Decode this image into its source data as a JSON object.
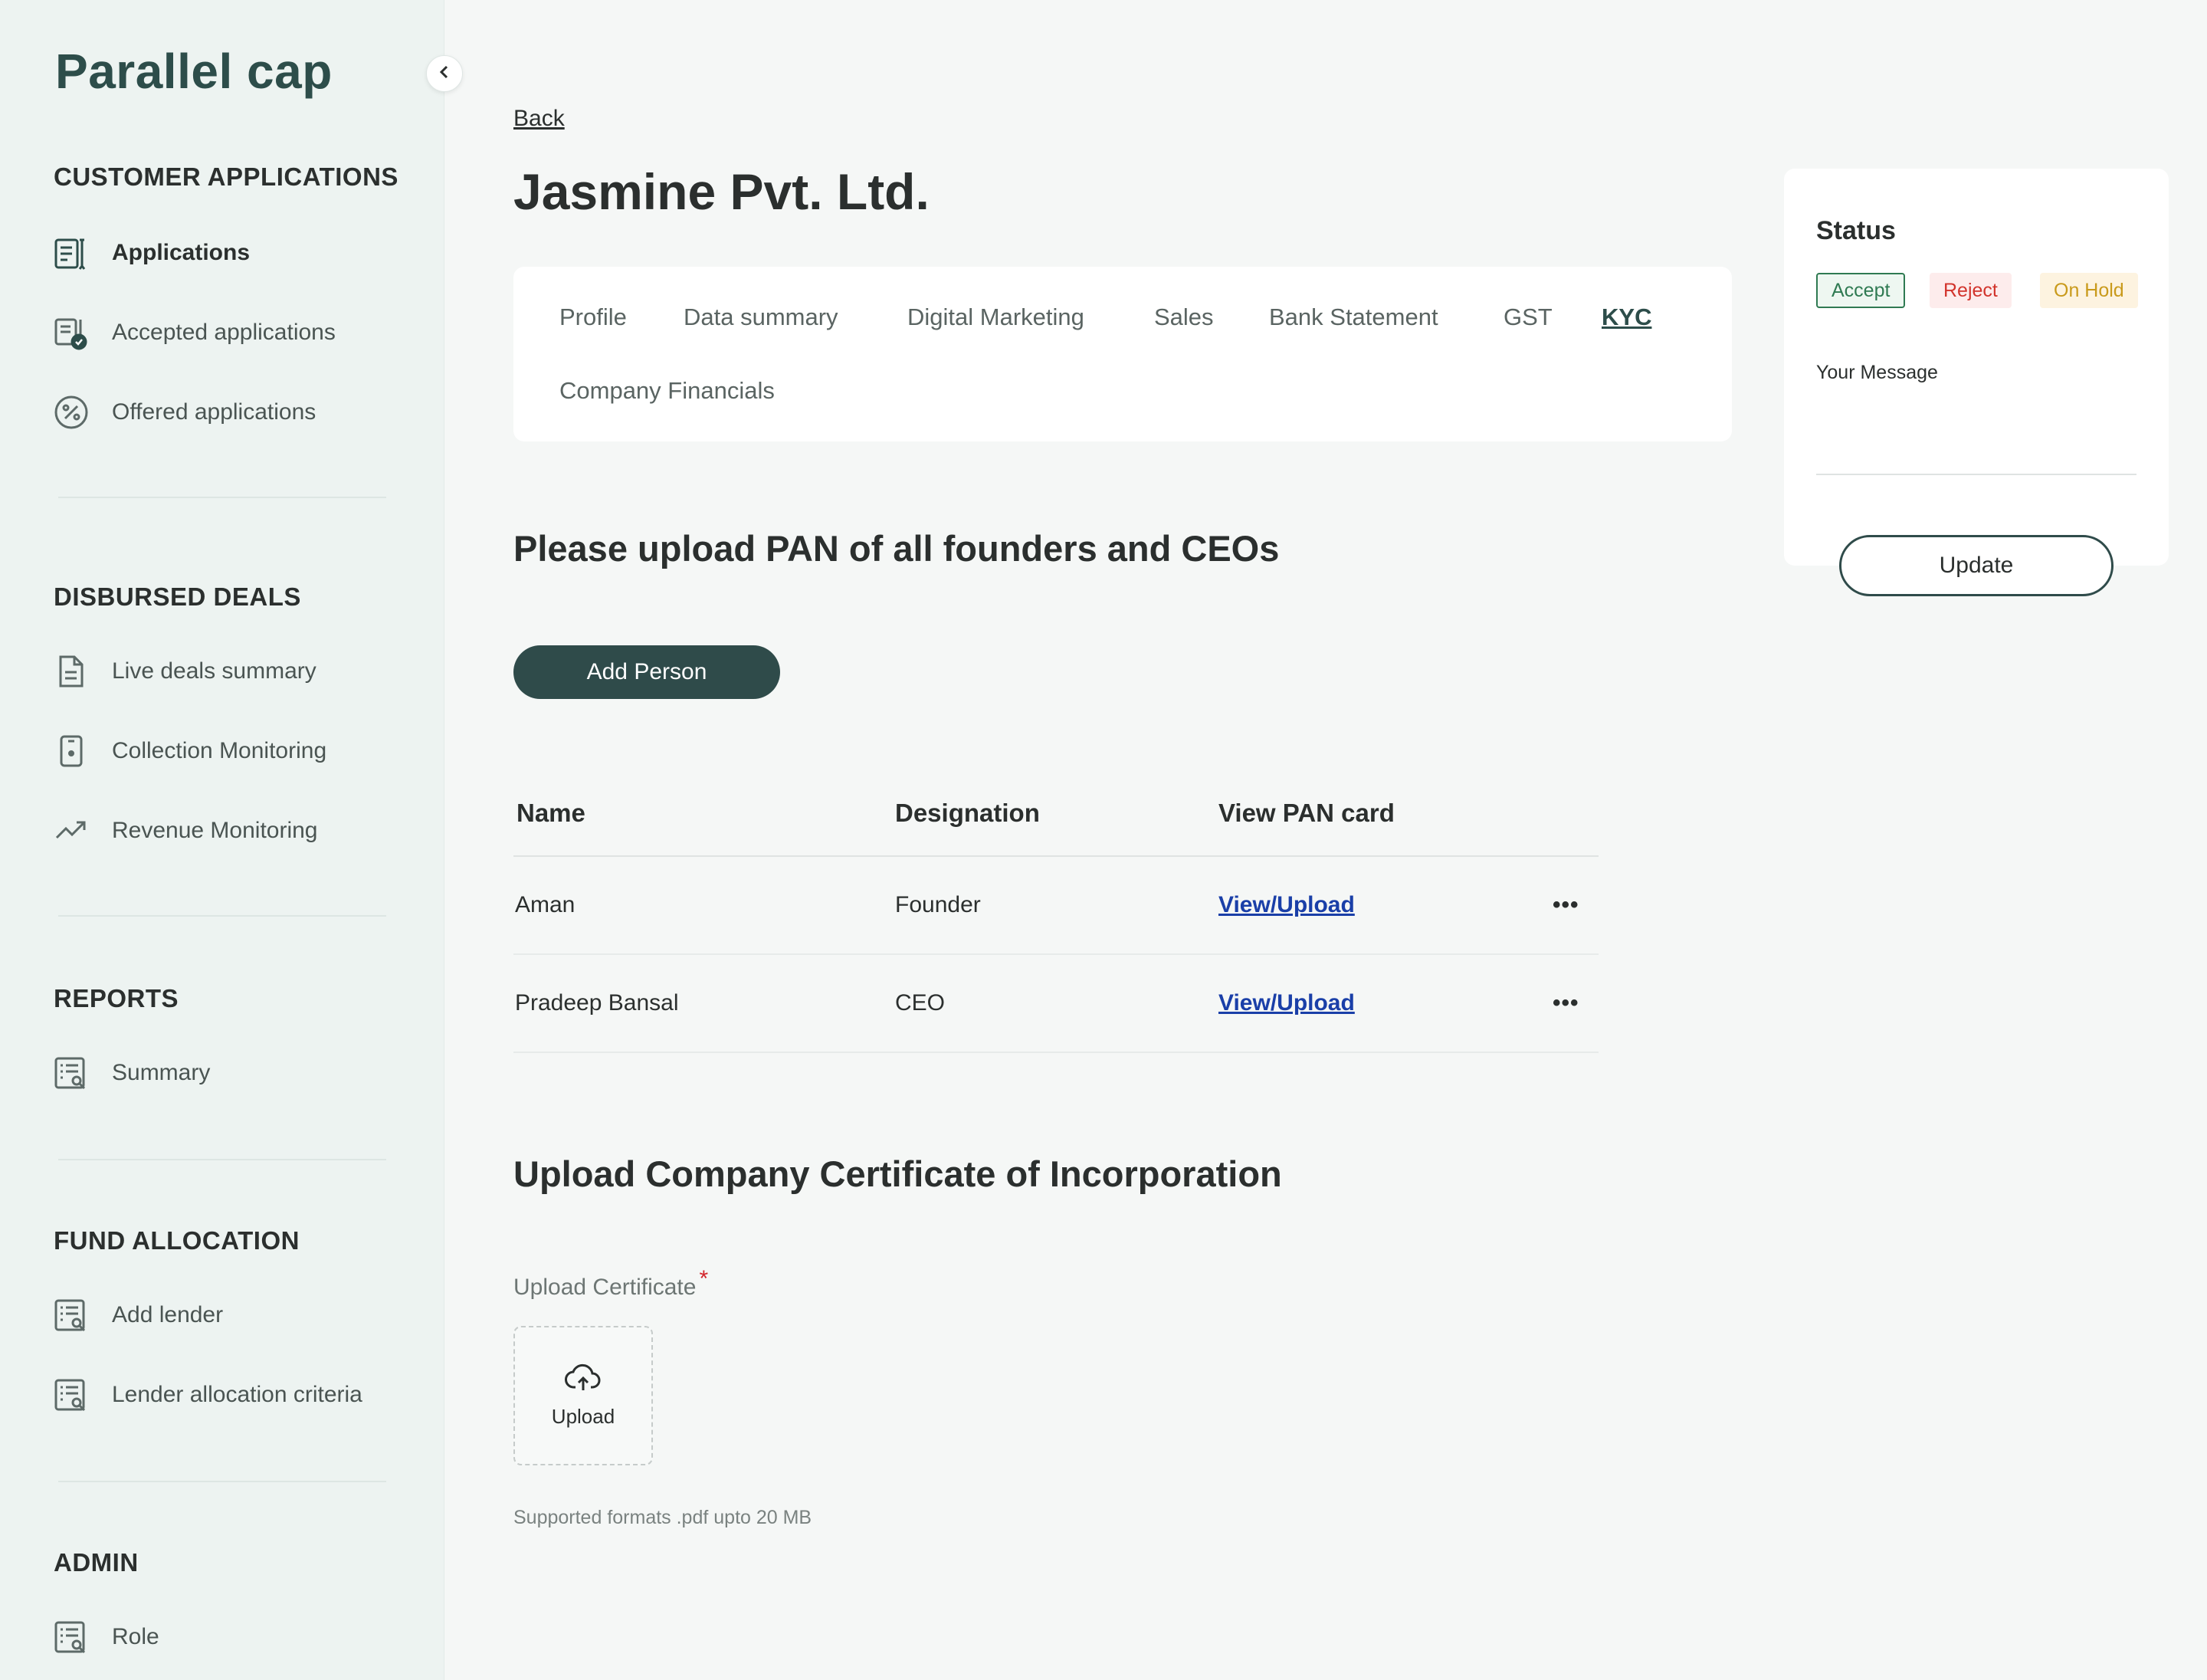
{
  "app": {
    "brand": "Parallel cap"
  },
  "sidebar": {
    "sections": [
      {
        "title": "CUSTOMER APPLICATIONS",
        "items": [
          {
            "label": "Applications",
            "icon": "applications-icon",
            "active": true
          },
          {
            "label": "Accepted applications",
            "icon": "accepted-applications-icon"
          },
          {
            "label": "Offered applications",
            "icon": "percent-icon"
          }
        ]
      },
      {
        "title": "DISBURSED DEALS",
        "items": [
          {
            "label": "Live deals summary",
            "icon": "document-icon"
          },
          {
            "label": "Collection Monitoring",
            "icon": "device-icon"
          },
          {
            "label": "Revenue Monitoring",
            "icon": "trending-up-icon"
          }
        ]
      },
      {
        "title": "REPORTS",
        "items": [
          {
            "label": "Summary",
            "icon": "report-search-icon"
          }
        ]
      },
      {
        "title": "FUND ALLOCATION",
        "items": [
          {
            "label": "Add lender",
            "icon": "report-search-icon"
          },
          {
            "label": "Lender allocation criteria",
            "icon": "report-search-icon"
          }
        ]
      },
      {
        "title": "ADMIN",
        "items": [
          {
            "label": "Role",
            "icon": "report-search-icon"
          }
        ]
      }
    ]
  },
  "main": {
    "back_label": "Back",
    "title": "Jasmine Pvt. Ltd.",
    "tabs": [
      {
        "label": "Profile"
      },
      {
        "label": "Data summary"
      },
      {
        "label": "Digital Marketing"
      },
      {
        "label": "Sales"
      },
      {
        "label": "Bank Statement"
      },
      {
        "label": "GST"
      },
      {
        "label": "KYC",
        "active": true
      },
      {
        "label": "Company Financials"
      }
    ],
    "pan_section": {
      "heading": "Please upload PAN of all founders and CEOs",
      "add_button": "Add Person",
      "columns": [
        "Name",
        "Designation",
        "View PAN card"
      ],
      "rows": [
        {
          "name": "Aman",
          "designation": "Founder",
          "link": "View/Upload",
          "more": "•••"
        },
        {
          "name": "Pradeep Bansal",
          "designation": "CEO",
          "link": "View/Upload",
          "more": "•••"
        }
      ]
    },
    "certificate_section": {
      "heading": "Upload Company Certificate of Incorporation",
      "label": "Upload Certificate",
      "required_mark": "*",
      "upload_button": "Upload",
      "hint": "Supported formats .pdf upto 20 MB"
    }
  },
  "status_panel": {
    "title": "Status",
    "options": {
      "accept": "Accept",
      "reject": "Reject",
      "hold": "On Hold"
    },
    "message_label": "Your Message",
    "message_value": "",
    "update_button": "Update"
  },
  "colors": {
    "brand": "#2d4d4a",
    "primary_button": "#2f4b4a",
    "link": "#1a3fa8",
    "accept": "#2f7a52",
    "reject": "#d2342c",
    "hold": "#c99a1b"
  }
}
